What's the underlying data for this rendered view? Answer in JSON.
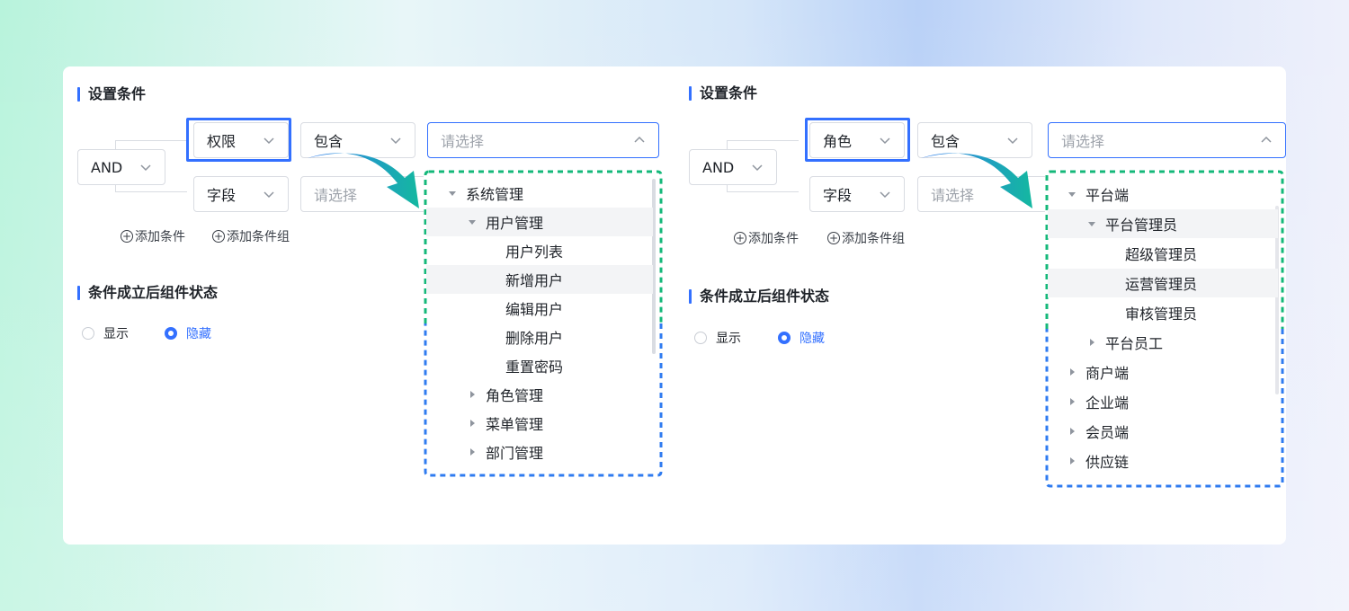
{
  "left": {
    "section1_title": "设置条件",
    "logic": "AND",
    "row1": {
      "field": "权限",
      "op": "包含",
      "value_placeholder": "请选择"
    },
    "row2": {
      "field": "字段",
      "value_placeholder": "请选择"
    },
    "add_condition": "添加条件",
    "add_group": "添加条件组",
    "section2_title": "条件成立后组件状态",
    "radio_show": "显示",
    "radio_hide": "隐藏",
    "tree": {
      "n1": "系统管理",
      "n2": "用户管理",
      "n3": "用户列表",
      "n4": "新增用户",
      "n5": "编辑用户",
      "n6": "删除用户",
      "n7": "重置密码",
      "n8": "角色管理",
      "n9": "菜单管理",
      "n10": "部门管理"
    }
  },
  "right": {
    "section1_title": "设置条件",
    "logic": "AND",
    "row1": {
      "field": "角色",
      "op": "包含",
      "value_placeholder": "请选择"
    },
    "row2": {
      "field": "字段",
      "value_placeholder": "请选择"
    },
    "add_condition": "添加条件",
    "add_group": "添加条件组",
    "section2_title": "条件成立后组件状态",
    "radio_show": "显示",
    "radio_hide": "隐藏",
    "tree": {
      "n1": "平台端",
      "n2": "平台管理员",
      "n3": "超级管理员",
      "n4": "运营管理员",
      "n5": "审核管理员",
      "n6": "平台员工",
      "n7": "商户端",
      "n8": "企业端",
      "n9": "会员端",
      "n10": "供应链"
    }
  },
  "colors": {
    "accent": "#3370ff",
    "dash_green": "#14b87a",
    "dash_blue": "#2f7bf0"
  },
  "selected_radio": "hide"
}
